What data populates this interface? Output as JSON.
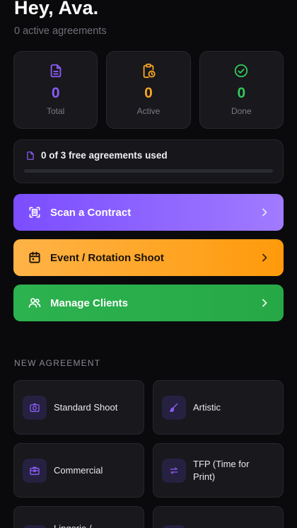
{
  "header": {
    "greeting": "Hey, Ava.",
    "subtitle": "0 active agreements"
  },
  "stats": [
    {
      "value": "0",
      "label": "Total",
      "icon": "document-icon",
      "color": "#8b5cf6"
    },
    {
      "value": "0",
      "label": "Active",
      "icon": "clipboard-clock-icon",
      "color": "#f5a524"
    },
    {
      "value": "0",
      "label": "Done",
      "icon": "check-circle-icon",
      "color": "#34c759"
    }
  ],
  "usage": {
    "text": "0 of 3 free agreements used",
    "used": 0,
    "limit": 3,
    "icon": "document-icon"
  },
  "actions": {
    "scan": {
      "label": "Scan a Contract",
      "icon": "scan-icon"
    },
    "event": {
      "label": "Event / Rotation Shoot",
      "icon": "calendar-icon"
    },
    "clients": {
      "label": "Manage Clients",
      "icon": "users-icon"
    }
  },
  "new_agreement": {
    "title": "NEW AGREEMENT",
    "items": [
      {
        "label": "Standard Shoot",
        "icon": "camera-icon"
      },
      {
        "label": "Artistic",
        "icon": "brush-icon"
      },
      {
        "label": "Commercial",
        "icon": "briefcase-icon"
      },
      {
        "label": "TFP (Time for Print)",
        "icon": "swap-icon"
      },
      {
        "label": "Lingerie /",
        "icon": "generic-icon"
      },
      {
        "label": "",
        "icon": "generic-icon"
      }
    ]
  },
  "colors": {
    "accent": "#8b5cf6",
    "active": "#f5a524",
    "done": "#34c759",
    "background": "#0a0a0c"
  }
}
